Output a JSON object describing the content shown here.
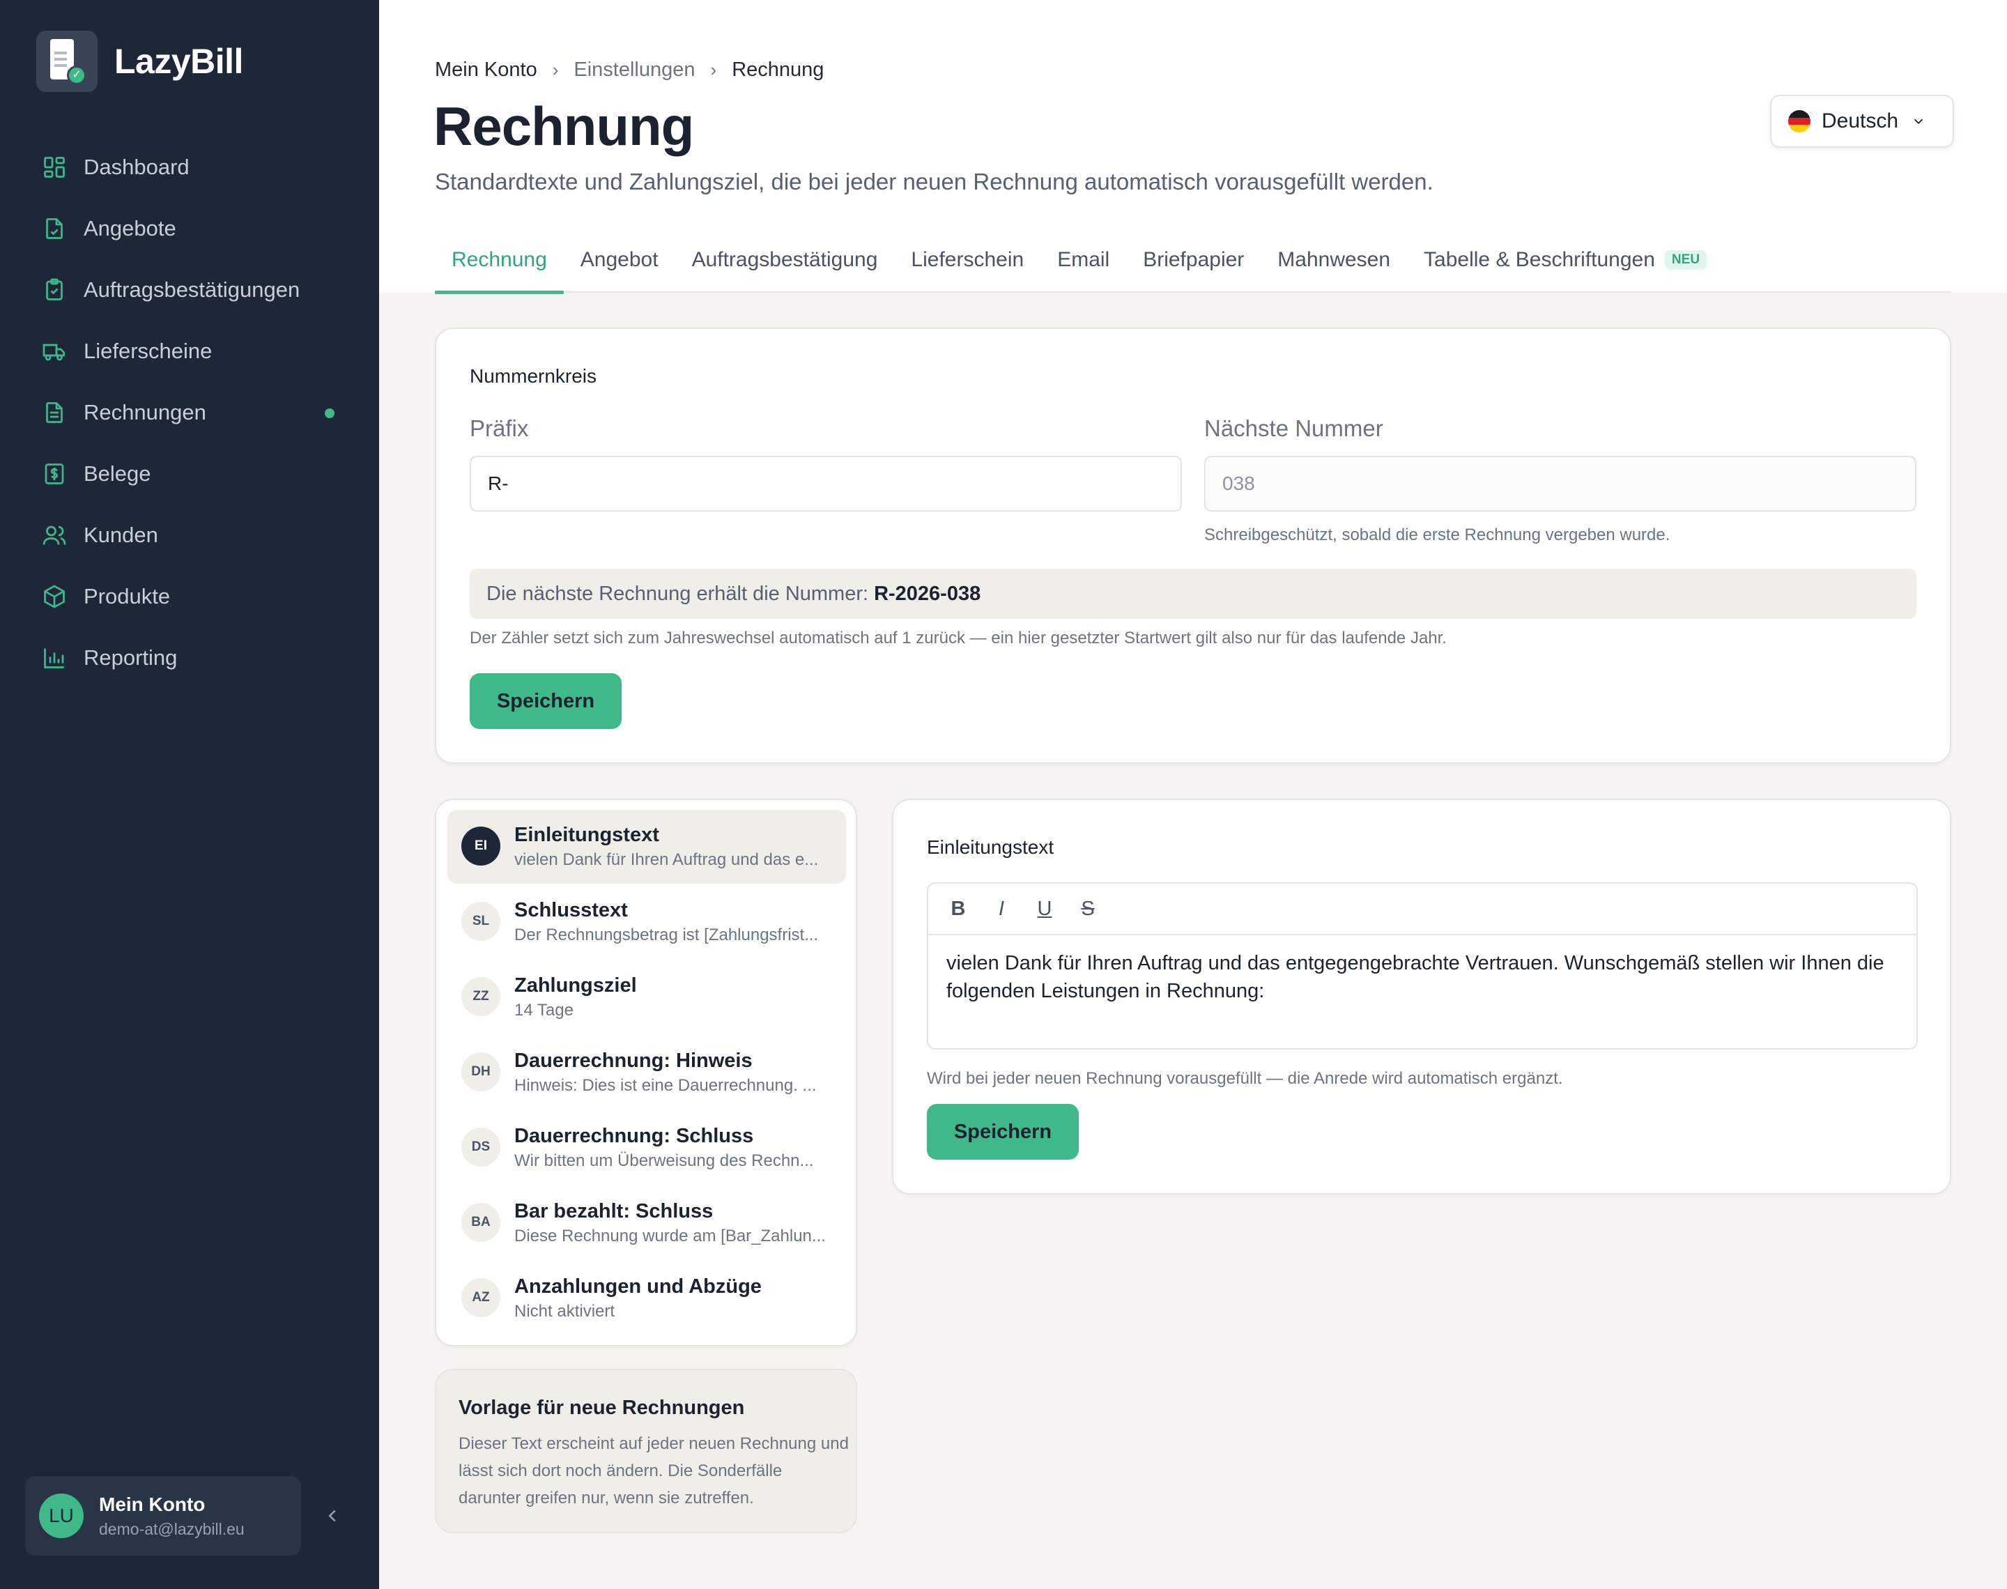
{
  "brand": {
    "name": "LazyBill"
  },
  "sidebar": {
    "items": [
      {
        "label": "Dashboard",
        "icon": "dashboard-icon"
      },
      {
        "label": "Angebote",
        "icon": "offer-icon"
      },
      {
        "label": "Auftragsbestätigungen",
        "icon": "clipboard-check-icon"
      },
      {
        "label": "Lieferscheine",
        "icon": "truck-icon"
      },
      {
        "label": "Rechnungen",
        "icon": "invoice-icon",
        "active_dot": true
      },
      {
        "label": "Belege",
        "icon": "receipt-icon"
      },
      {
        "label": "Kunden",
        "icon": "users-icon"
      },
      {
        "label": "Produkte",
        "icon": "box-icon"
      },
      {
        "label": "Reporting",
        "icon": "bar-chart-icon"
      }
    ],
    "account": {
      "initials": "LU",
      "name": "Mein Konto",
      "email": "demo-at@lazybill.eu"
    }
  },
  "breadcrumb": [
    "Mein Konto",
    "Einstellungen",
    "Rechnung"
  ],
  "page": {
    "title": "Rechnung",
    "subtitle": "Standardtexte und Zahlungsziel, die bei jeder neuen Rechnung automatisch vorausgefüllt werden."
  },
  "language": {
    "selected": "Deutsch"
  },
  "tabs": [
    {
      "label": "Rechnung",
      "active": true
    },
    {
      "label": "Angebot"
    },
    {
      "label": "Auftragsbestätigung"
    },
    {
      "label": "Lieferschein"
    },
    {
      "label": "Email"
    },
    {
      "label": "Briefpapier"
    },
    {
      "label": "Mahnwesen"
    },
    {
      "label": "Tabelle & Beschriftungen",
      "badge": "NEU"
    }
  ],
  "nummernkreis": {
    "heading": "Nummernkreis",
    "prefix_label": "Präfix",
    "prefix_value": "R-",
    "next_label": "Nächste Nummer",
    "next_value": "038",
    "next_hint": "Schreibgeschützt, sobald die erste Rechnung vergeben wurde.",
    "preview_text": "Die nächste Rechnung erhält die Nummer:",
    "preview_number": "R-2026-038",
    "reset_hint": "Der Zähler setzt sich zum Jahreswechsel automatisch auf 1 zurück — ein hier gesetzter Startwert gilt also nur für das laufende Jahr.",
    "save_label": "Speichern"
  },
  "textblocks": [
    {
      "badge": "EI",
      "title": "Einleitungstext",
      "sub": "vielen Dank für Ihren Auftrag und das e...",
      "active": true
    },
    {
      "badge": "SL",
      "title": "Schlusstext",
      "sub": "Der Rechnungsbetrag ist [Zahlungsfrist..."
    },
    {
      "badge": "ZZ",
      "title": "Zahlungsziel",
      "sub": "14 Tage"
    },
    {
      "badge": "DH",
      "title": "Dauerrechnung: Hinweis",
      "sub": "Hinweis: Dies ist eine Dauerrechnung. ..."
    },
    {
      "badge": "DS",
      "title": "Dauerrechnung: Schluss",
      "sub": "Wir bitten um Überweisung des Rechn..."
    },
    {
      "badge": "BA",
      "title": "Bar bezahlt: Schluss",
      "sub": "Diese Rechnung wurde am [Bar_Zahlun..."
    },
    {
      "badge": "AZ",
      "title": "Anzahlungen und Abzüge",
      "sub": "Nicht aktiviert"
    }
  ],
  "info": {
    "title": "Vorlage für neue Rechnungen",
    "text": "Dieser Text erscheint auf jeder neuen Rechnung und lässt sich dort noch ändern. Die Sonderfälle darunter greifen nur, wenn sie zutreffen."
  },
  "editor": {
    "heading": "Einleitungstext",
    "toolbar": {
      "bold": "B",
      "italic": "I",
      "underline": "U",
      "strike": "S"
    },
    "content": "vielen Dank für Ihren Auftrag und das entgegengebrachte Vertrauen. Wunschgemäß stellen wir Ihnen die folgenden Leistungen in Rechnung:",
    "hint": "Wird bei jeder neuen Rechnung vorausgefüllt — die Anrede wird automatisch ergänzt.",
    "save_label": "Speichern"
  },
  "colors": {
    "accent": "#3fb98a",
    "sidebar": "#1d2738",
    "background": "#f5f4f1"
  }
}
